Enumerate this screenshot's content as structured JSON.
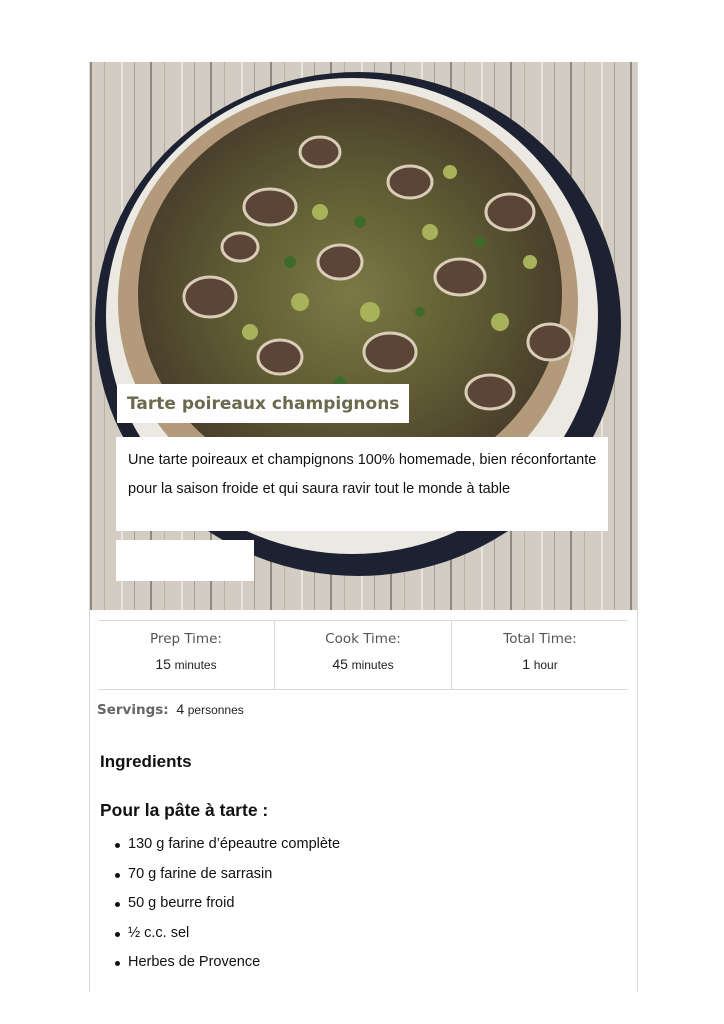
{
  "recipe": {
    "title": "Tarte poireaux champignons",
    "description": "Une tarte poireaux et champignons 100% homemade, bien réconfortante pour la saison froide et qui saura ravir tout le monde à table"
  },
  "times": {
    "prep": {
      "label": "Prep Time:",
      "value": "15",
      "unit": "minutes"
    },
    "cook": {
      "label": "Cook Time:",
      "value": "45",
      "unit": "minutes"
    },
    "total": {
      "label": "Total Time:",
      "value": "1",
      "unit": "hour"
    }
  },
  "servings": {
    "label": "Servings:",
    "value": "4",
    "unit": "personnes"
  },
  "ingredients": {
    "heading": "Ingredients",
    "group": "Pour la pâte à tarte :",
    "items": [
      "130 g farine d’épeautre complète",
      "70 g farine de sarrasin",
      "50 g beurre froid",
      "½ c.c. sel",
      "Herbes de Provence"
    ]
  },
  "colors": {
    "title_text": "#6b6a4f",
    "plank": "#cfc8bd",
    "plate": "#1d2233",
    "crust": "#b39a7a",
    "filling": "#6f6b3d"
  },
  "icons": {
    "hero": "quiche-photo"
  }
}
